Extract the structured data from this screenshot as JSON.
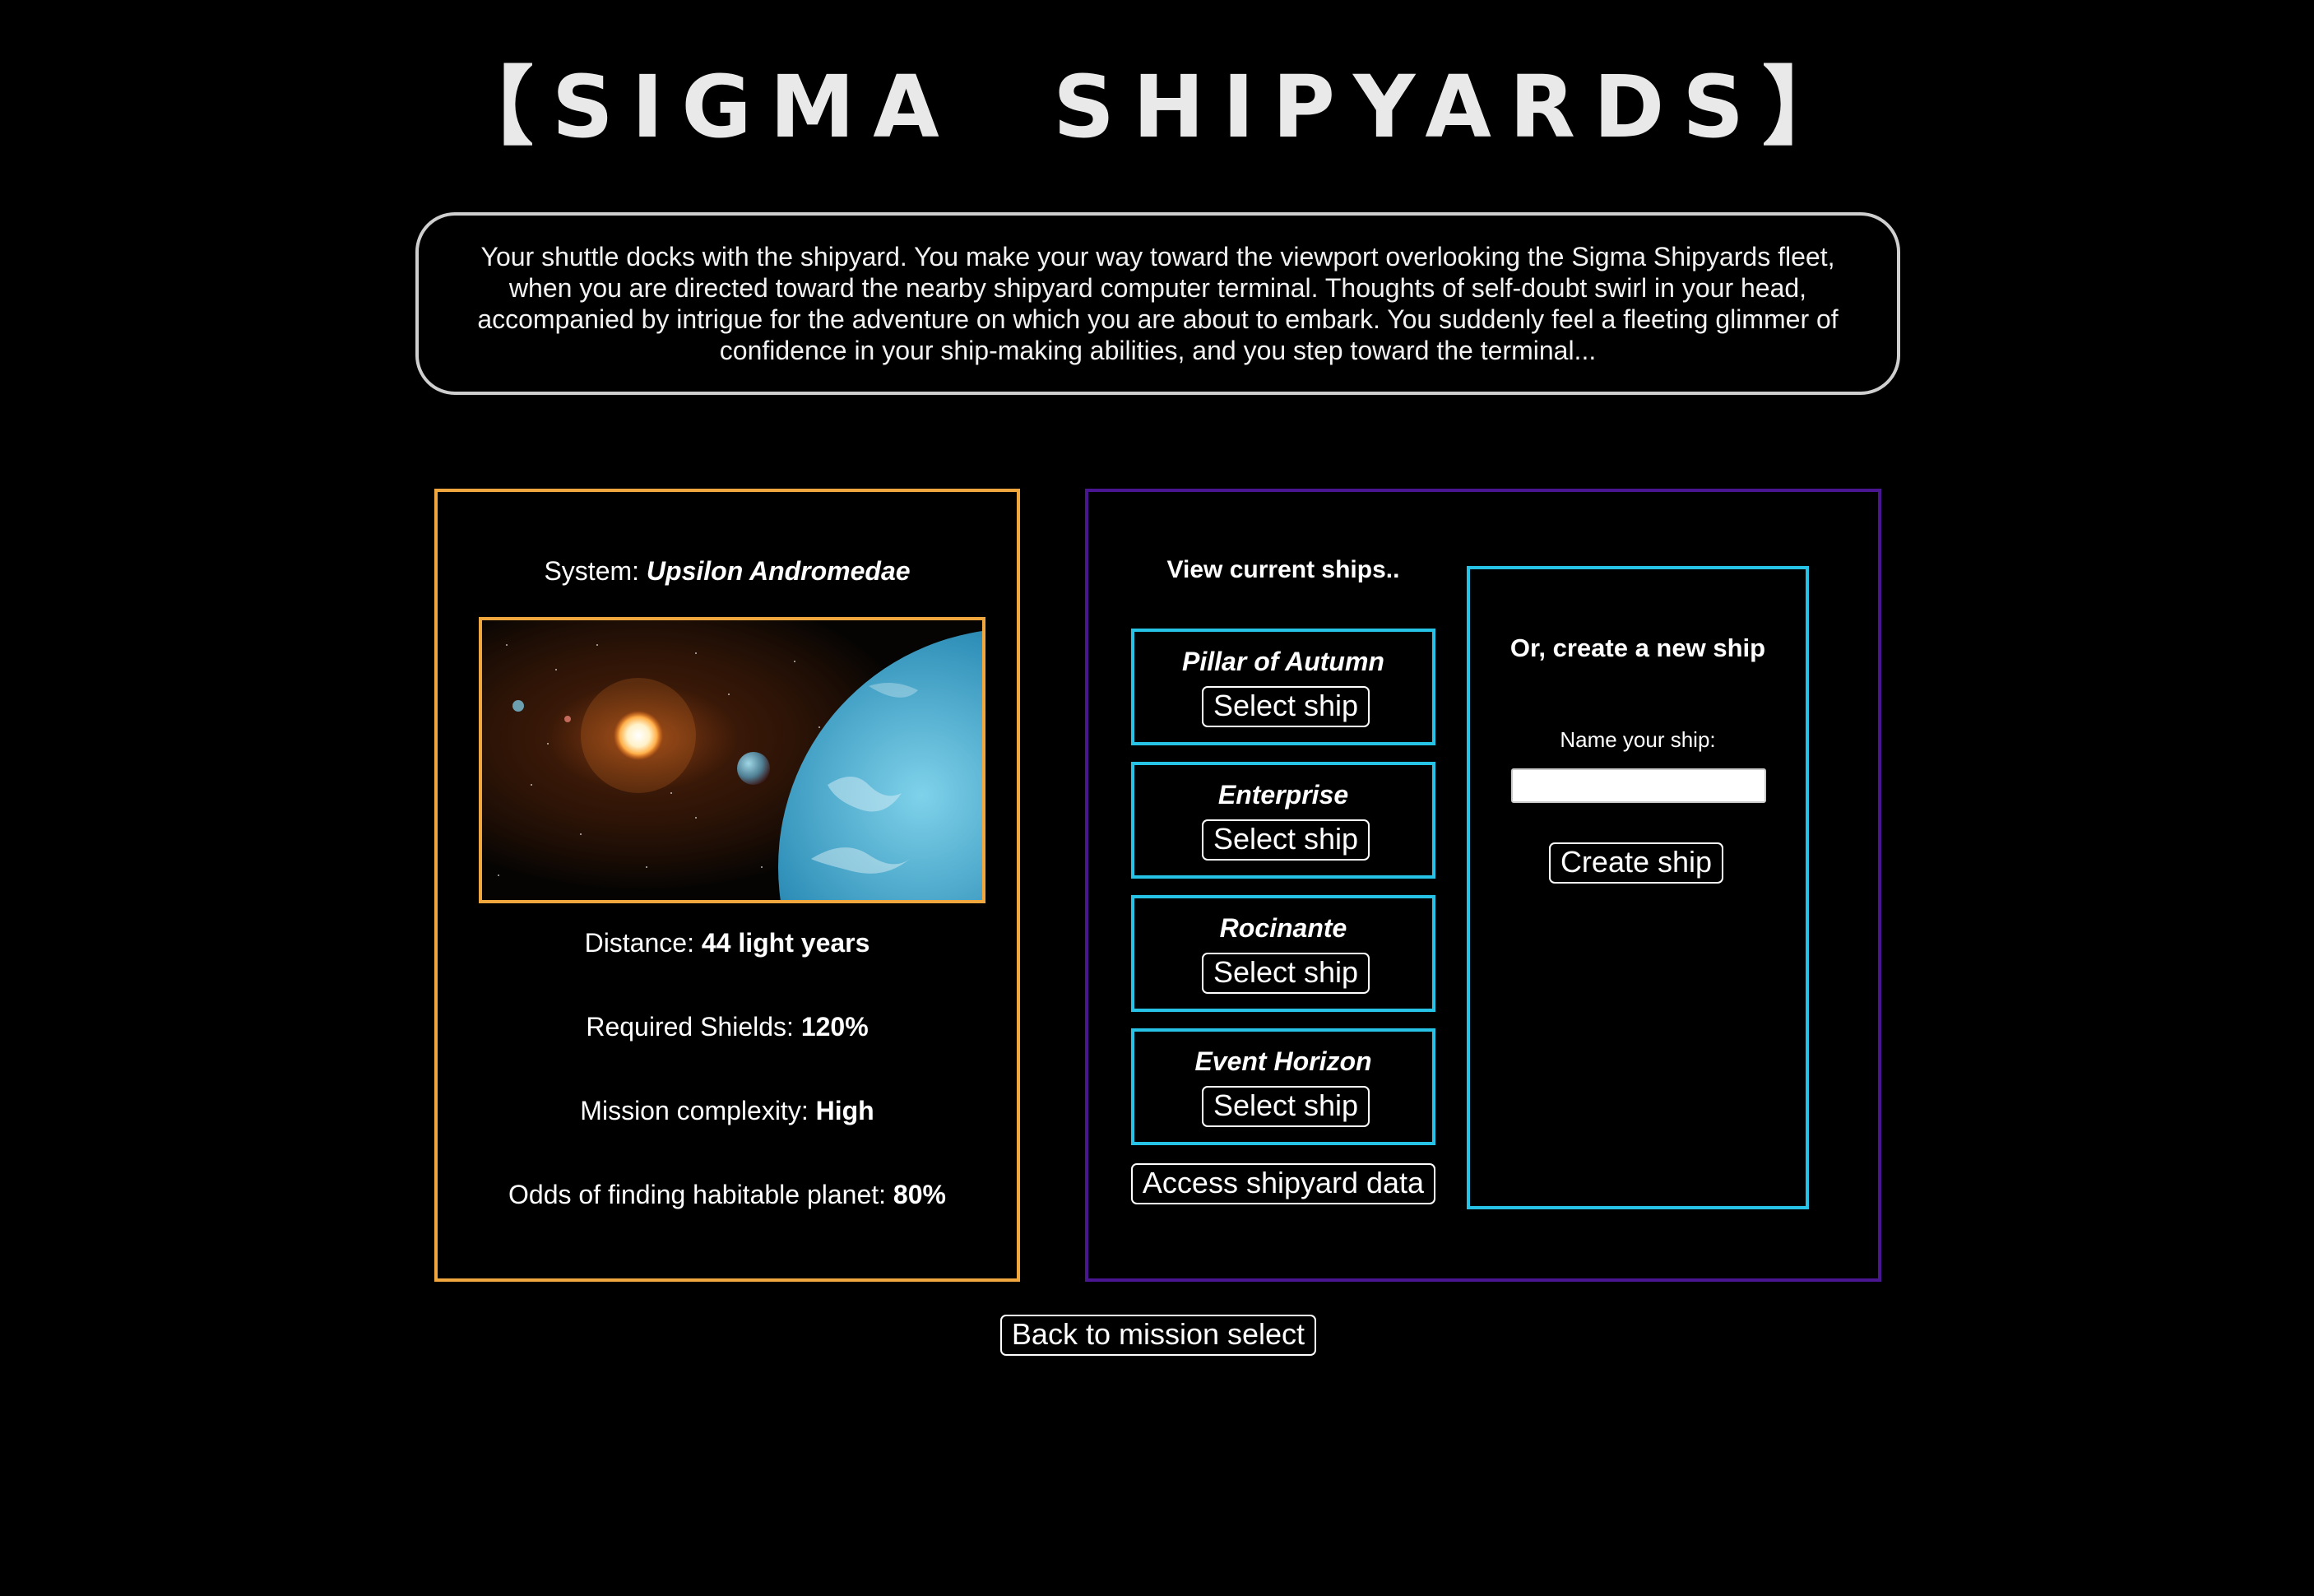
{
  "header": {
    "title": "【SIGMA  SHIPYARDS】"
  },
  "intro": {
    "text": "Your shuttle docks with the shipyard. You make your way toward the viewport overlooking the Sigma Shipyards fleet, when you are directed toward the nearby shipyard computer terminal. Thoughts of self-doubt swirl in your head, accompanied by intrigue for the adventure on which you are about to embark. You suddenly feel a fleeting glimmer of confidence in your ship-making abilities, and you step toward the terminal..."
  },
  "mission": {
    "system_label": "System: ",
    "system_value": "Upsilon Andromedae",
    "image_icon": "planet-system-image",
    "distance_label": "Distance: ",
    "distance_value": "44 light years",
    "shields_label": "Required Shields: ",
    "shields_value": "120%",
    "complexity_label": "Mission complexity: ",
    "complexity_value": "High",
    "odds_label": "Odds of finding habitable planet: ",
    "odds_value": "80%"
  },
  "ships": {
    "view_label": "View current ships..",
    "list": [
      {
        "name": "Pillar of Autumn",
        "button": "Select ship"
      },
      {
        "name": "Enterprise",
        "button": "Select ship"
      },
      {
        "name": "Rocinante",
        "button": "Select ship"
      },
      {
        "name": "Event Horizon",
        "button": "Select ship"
      }
    ],
    "access_button": "Access shipyard data"
  },
  "create": {
    "title": "Or, create a new ship",
    "name_label": "Name your ship:",
    "name_value": "",
    "create_button": "Create ship"
  },
  "footer": {
    "back_button": "Back to mission select"
  },
  "colors": {
    "background": "#000000",
    "mission_border": "#f0a73d",
    "ships_border": "#4a1591",
    "card_border": "#27c3e6",
    "intro_border": "#cfcfcf"
  }
}
